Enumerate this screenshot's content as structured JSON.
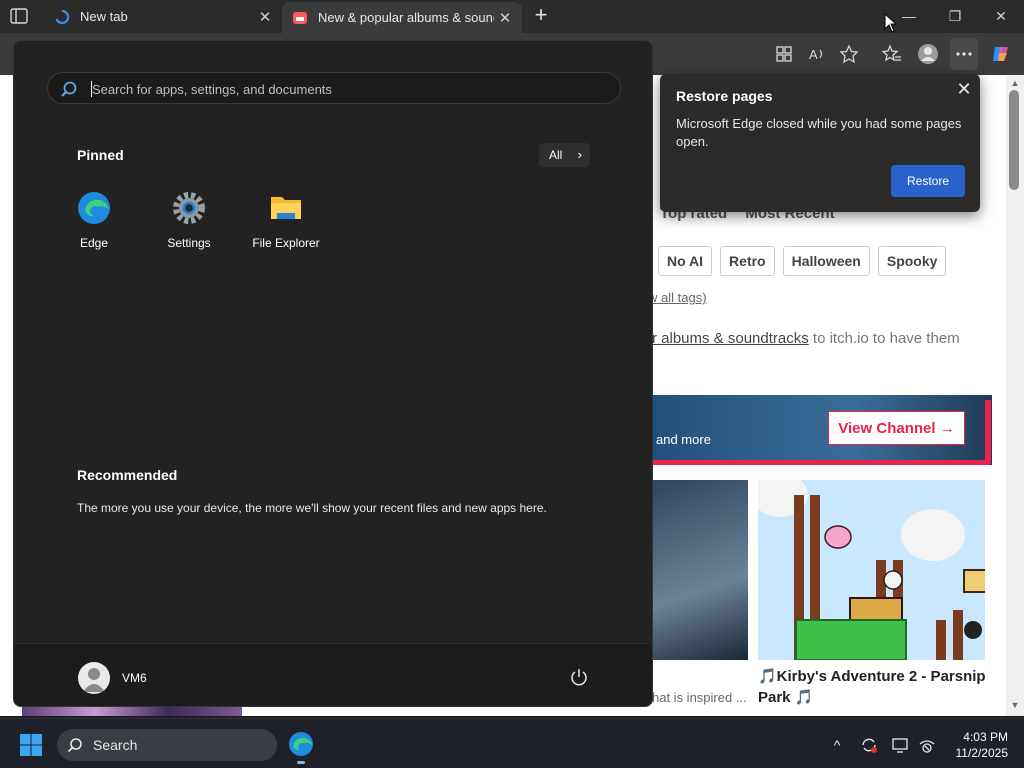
{
  "tabs": [
    {
      "title": "New tab",
      "close": "✕"
    },
    {
      "title": "New & popular albums & soundtracks",
      "close": "✕"
    }
  ],
  "newtab_symbol": "+",
  "window_controls": {
    "minimize": "—",
    "maximize": "❐",
    "close": "✕"
  },
  "browser_icons": [
    "apps-icon",
    "read-aloud-icon",
    "favorite-star-icon",
    "favorites-icon",
    "profile-icon",
    "more-icon",
    "copilot-icon"
  ],
  "restore_popup": {
    "title": "Restore pages",
    "message": "Microsoft Edge closed while you had some pages open.",
    "button": "Restore",
    "close": "✕"
  },
  "page": {
    "sort_links": [
      "Top rated",
      "Most Recent"
    ],
    "tags": [
      "No AI",
      "Retro",
      "Halloween",
      "Spooky"
    ],
    "view_all_tags": "w all tags)",
    "submit_link": "r albums & soundtracks",
    "submit_rest": " to itch.io to have them",
    "banner_text": "and more",
    "view_channel": "View Channel →",
    "caption_left": "hat is inspired ...",
    "caption_right": "🎵Kirby's Adventure 2 - Parsnip Park 🎵"
  },
  "start_menu": {
    "search_placeholder": "Search for apps, settings, and documents",
    "pinned_heading": "Pinned",
    "all_button": "All",
    "all_chevron": "›",
    "apps": [
      {
        "label": "Edge",
        "icon": "edge-icon"
      },
      {
        "label": "Settings",
        "icon": "settings-gear-icon"
      },
      {
        "label": "File Explorer",
        "icon": "folder-icon"
      }
    ],
    "recommended_heading": "Recommended",
    "recommended_text": "The more you use your device, the more we'll show your recent files and new apps here.",
    "user_name": "VM6"
  },
  "taskbar": {
    "search_label": "Search",
    "tray": {
      "chevron": "^",
      "time": "4:03 PM",
      "date": "11/2/2025"
    }
  }
}
